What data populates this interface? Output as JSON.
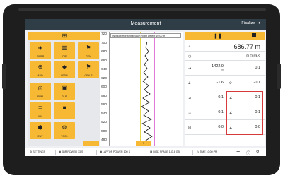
{
  "app": {
    "title": "Measurement",
    "finalize_label": "Finalize"
  },
  "left_tiles": [
    {
      "icon": "⊞",
      "label": ""
    },
    {
      "icon": "◈",
      "label": "SWEP"
    },
    {
      "icon": "▥",
      "label": "OIS"
    },
    {
      "icon": "⚑",
      "label": "GEN"
    },
    {
      "icon": "⊕",
      "label": "ADD"
    },
    {
      "icon": "◆",
      "label": "LEDR"
    },
    {
      "icon": "⚑",
      "label": "GEN-S"
    },
    {
      "icon": "◎",
      "label": "PRM"
    },
    {
      "icon": "▣",
      "label": "DLR"
    },
    {
      "icon": "≣",
      "label": "IPL"
    },
    {
      "icon": "■",
      "label": ""
    },
    {
      "icon": "⬢",
      "label": "ENT"
    },
    {
      "icon": "⚙",
      "label": "TOOL"
    }
  ],
  "chart": {
    "tooltip": "Window Horizontal Short Right Detect 10:00 m",
    "y_ticks": [
      "720",
      "700",
      "680",
      "660",
      "640",
      "620",
      "600",
      "580",
      "560",
      "540",
      "520",
      "500",
      "480"
    ]
  },
  "right": {
    "depth": {
      "value": "686.77 m"
    },
    "speed": {
      "value": "0.0 m/s"
    },
    "r1": {
      "left": "1422.9",
      "left_unit": "m",
      "right": "0.1"
    },
    "r2": {
      "left": "-1.6",
      "right": "-0.1"
    },
    "r3": {
      "left": "-0.1",
      "right": "-0.1"
    },
    "r4": {
      "left": "-0.1",
      "right": "-0.1"
    },
    "r5": {
      "left": "0.0",
      "right": "0.0"
    }
  },
  "status": [
    {
      "label": "SETTINGS"
    },
    {
      "label": "SBR POWER 33 S"
    },
    {
      "label": "LAPTOP POWER 100 S"
    },
    {
      "label": "DISK SPACE 183.8 GB"
    },
    {
      "label": "TIME 10:00 PM"
    }
  ]
}
